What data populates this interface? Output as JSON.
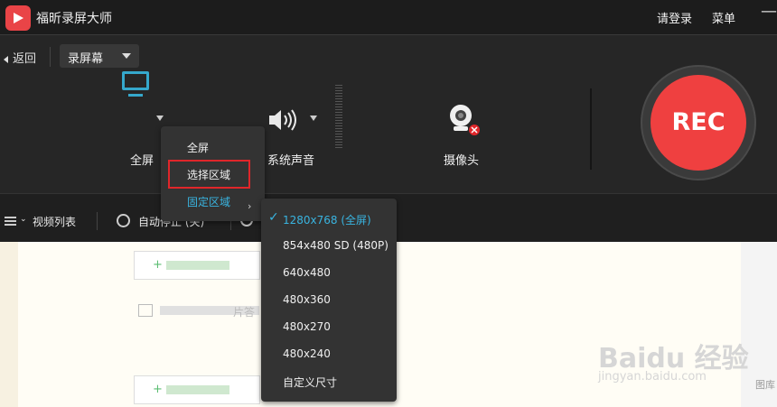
{
  "app": {
    "title": "福昕录屏大师",
    "login": "请登录",
    "menu": "菜单",
    "minimize": "—"
  },
  "toolbar": {
    "back": "返回",
    "mode": "录屏幕",
    "screen_label": "全屏",
    "audio_label": "系统声音",
    "camera_label": "摄像头",
    "rec": "REC"
  },
  "subbar": {
    "video_list": "视频列表",
    "auto_stop": "自动停止 (关)"
  },
  "dropdown": {
    "items": [
      "全屏",
      "选择区域",
      "固定区域"
    ],
    "active_index": 2,
    "highlighted_index": 1
  },
  "submenu": {
    "checkmark": "✓",
    "items": [
      "1280x768 (全屏)",
      "854x480 SD (480P)",
      "640x480",
      "480x360",
      "480x270",
      "480x240",
      "自定义尺寸"
    ],
    "selected_index": 0
  },
  "content": {
    "add_plus": "+",
    "img_text": "片答"
  },
  "watermark": {
    "brand": "Baidu 经验",
    "url": "jingyan.baidu.com",
    "side": "图库"
  },
  "colors": {
    "accent": "#39b4e0",
    "rec": "#ef4040",
    "highlight_border": "#e0262a",
    "add_green": "#5bbd72"
  }
}
